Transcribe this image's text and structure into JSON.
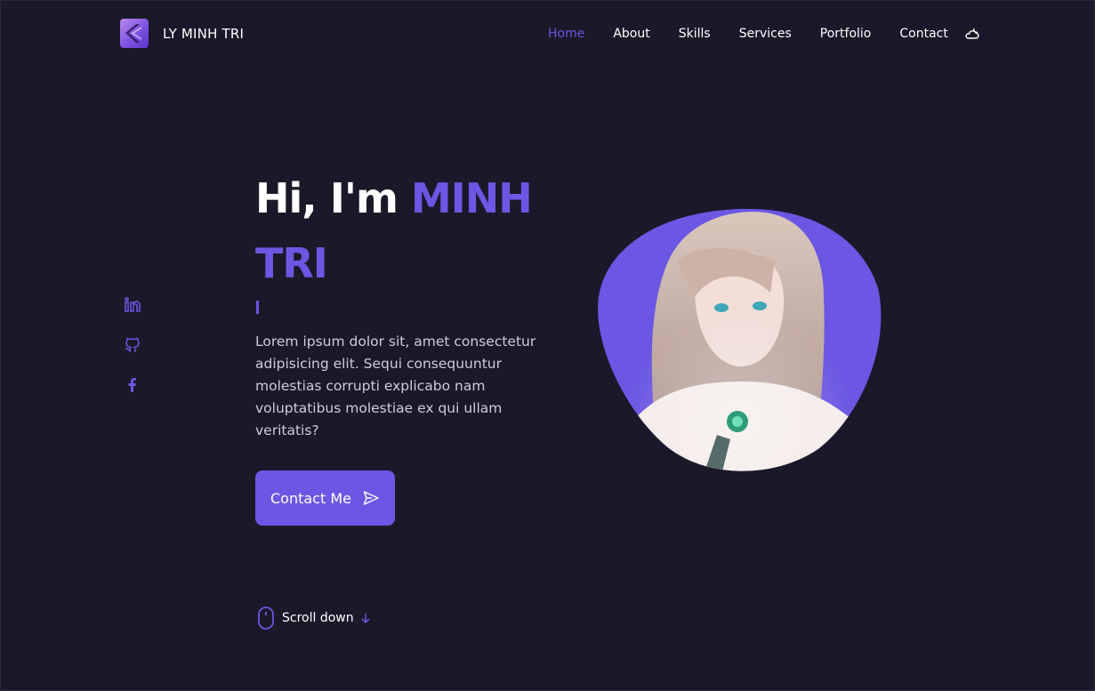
{
  "header": {
    "logo_text": "LY MINH TRI",
    "nav": [
      {
        "label": "Home",
        "active": true
      },
      {
        "label": "About",
        "active": false
      },
      {
        "label": "Skills",
        "active": false
      },
      {
        "label": "Services",
        "active": false
      },
      {
        "label": "Portfolio",
        "active": false
      },
      {
        "label": "Contact",
        "active": false
      }
    ],
    "theme_icon": "moon-cloud-icon"
  },
  "social": [
    "linkedin-icon",
    "github-icon",
    "facebook-icon"
  ],
  "hero": {
    "greeting": "Hi, I'm ",
    "name": "MINH TRI",
    "description": "Lorem ipsum dolor sit, amet consectetur adipisicing elit. Sequi consequuntur molestias corrupti explicabo nam voluptatibus molestiae ex qui ullam veritatis?",
    "button_label": "Contact Me"
  },
  "scroll": {
    "label": "Scroll down"
  },
  "colors": {
    "accent": "#6b57e3",
    "background": "#1b1829"
  }
}
